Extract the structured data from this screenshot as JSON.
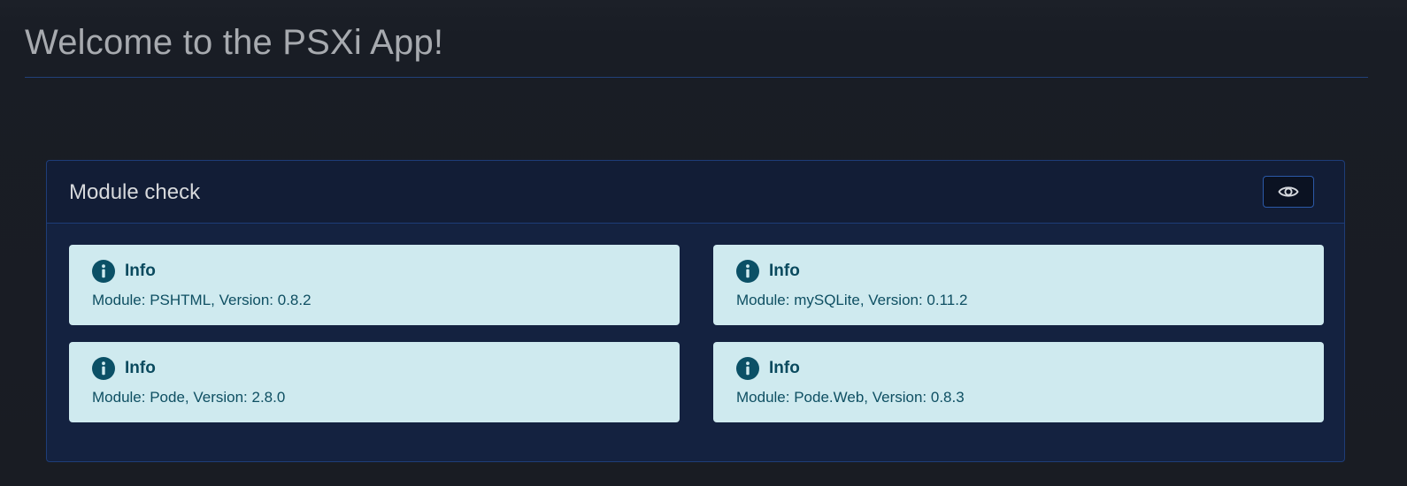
{
  "page": {
    "title": "Welcome to the PSXi App!"
  },
  "card": {
    "title": "Module check",
    "toggle_icon": "eye-icon"
  },
  "alerts": [
    {
      "icon": "info-circle-icon",
      "title": "Info",
      "text": "Module: PSHTML, Version: 0.8.2"
    },
    {
      "icon": "info-circle-icon",
      "title": "Info",
      "text": "Module: mySQLite, Version: 0.11.2"
    },
    {
      "icon": "info-circle-icon",
      "title": "Info",
      "text": "Module: Pode, Version: 2.8.0"
    },
    {
      "icon": "info-circle-icon",
      "title": "Info",
      "text": "Module: Pode.Web, Version: 0.8.3"
    }
  ],
  "colors": {
    "background": "#191d25",
    "card_body": "#142240",
    "card_header": "#121d36",
    "card_border": "#1e3d78",
    "alert_background": "#cfeaef",
    "alert_text": "#0a4a5e"
  }
}
